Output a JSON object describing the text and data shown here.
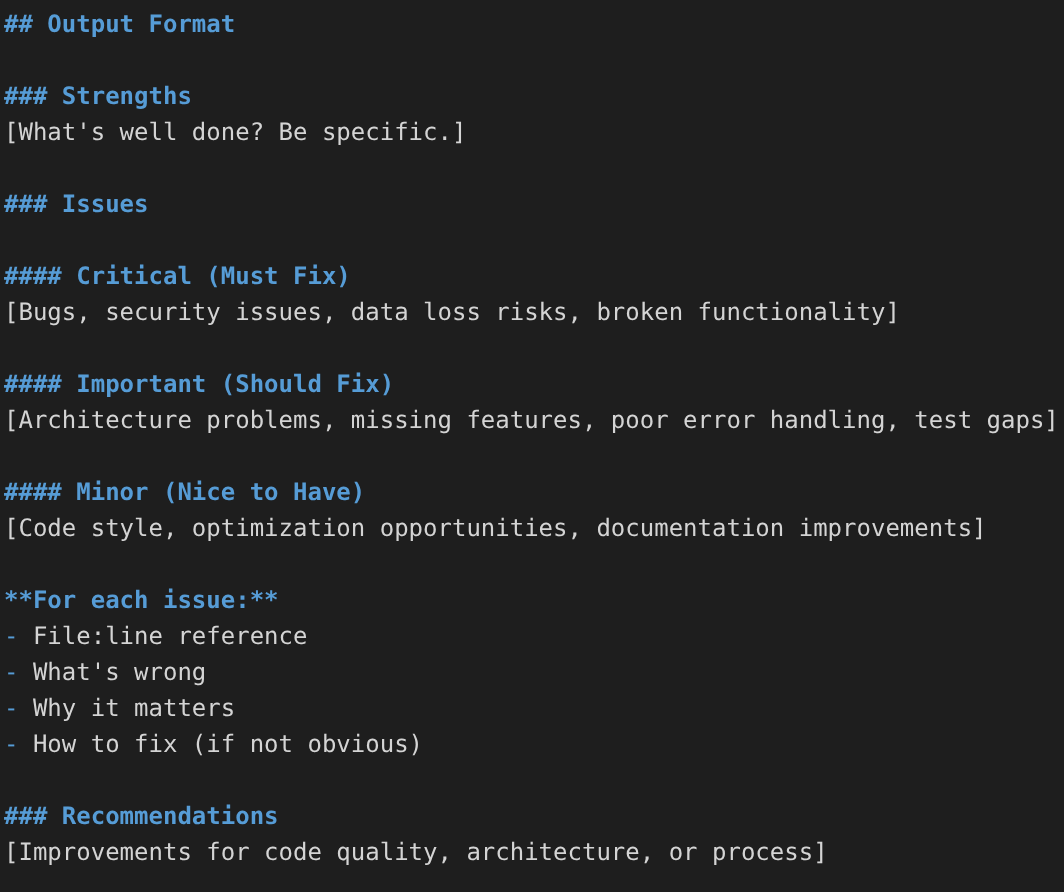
{
  "lines": [
    {
      "kind": "heading",
      "text": "## Output Format"
    },
    {
      "kind": "blank"
    },
    {
      "kind": "heading",
      "text": "### Strengths"
    },
    {
      "kind": "text",
      "text": "[What's well done? Be specific.]"
    },
    {
      "kind": "blank"
    },
    {
      "kind": "heading",
      "text": "### Issues"
    },
    {
      "kind": "blank"
    },
    {
      "kind": "heading",
      "text": "#### Critical (Must Fix)"
    },
    {
      "kind": "text",
      "text": "[Bugs, security issues, data loss risks, broken functionality]"
    },
    {
      "kind": "blank"
    },
    {
      "kind": "heading",
      "text": "#### Important (Should Fix)"
    },
    {
      "kind": "text",
      "text": "[Architecture problems, missing features, poor error handling, test gaps]"
    },
    {
      "kind": "blank"
    },
    {
      "kind": "heading",
      "text": "#### Minor (Nice to Have)"
    },
    {
      "kind": "text",
      "text": "[Code style, optimization opportunities, documentation improvements]"
    },
    {
      "kind": "blank"
    },
    {
      "kind": "bold",
      "text": "**For each issue:**"
    },
    {
      "kind": "list",
      "marker": "-",
      "text": "File:line reference"
    },
    {
      "kind": "list",
      "marker": "-",
      "text": "What's wrong"
    },
    {
      "kind": "list",
      "marker": "-",
      "text": "Why it matters"
    },
    {
      "kind": "list",
      "marker": "-",
      "text": "How to fix (if not obvious)"
    },
    {
      "kind": "blank"
    },
    {
      "kind": "heading",
      "text": "### Recommendations"
    },
    {
      "kind": "text",
      "text": "[Improvements for code quality, architecture, or process]"
    }
  ]
}
